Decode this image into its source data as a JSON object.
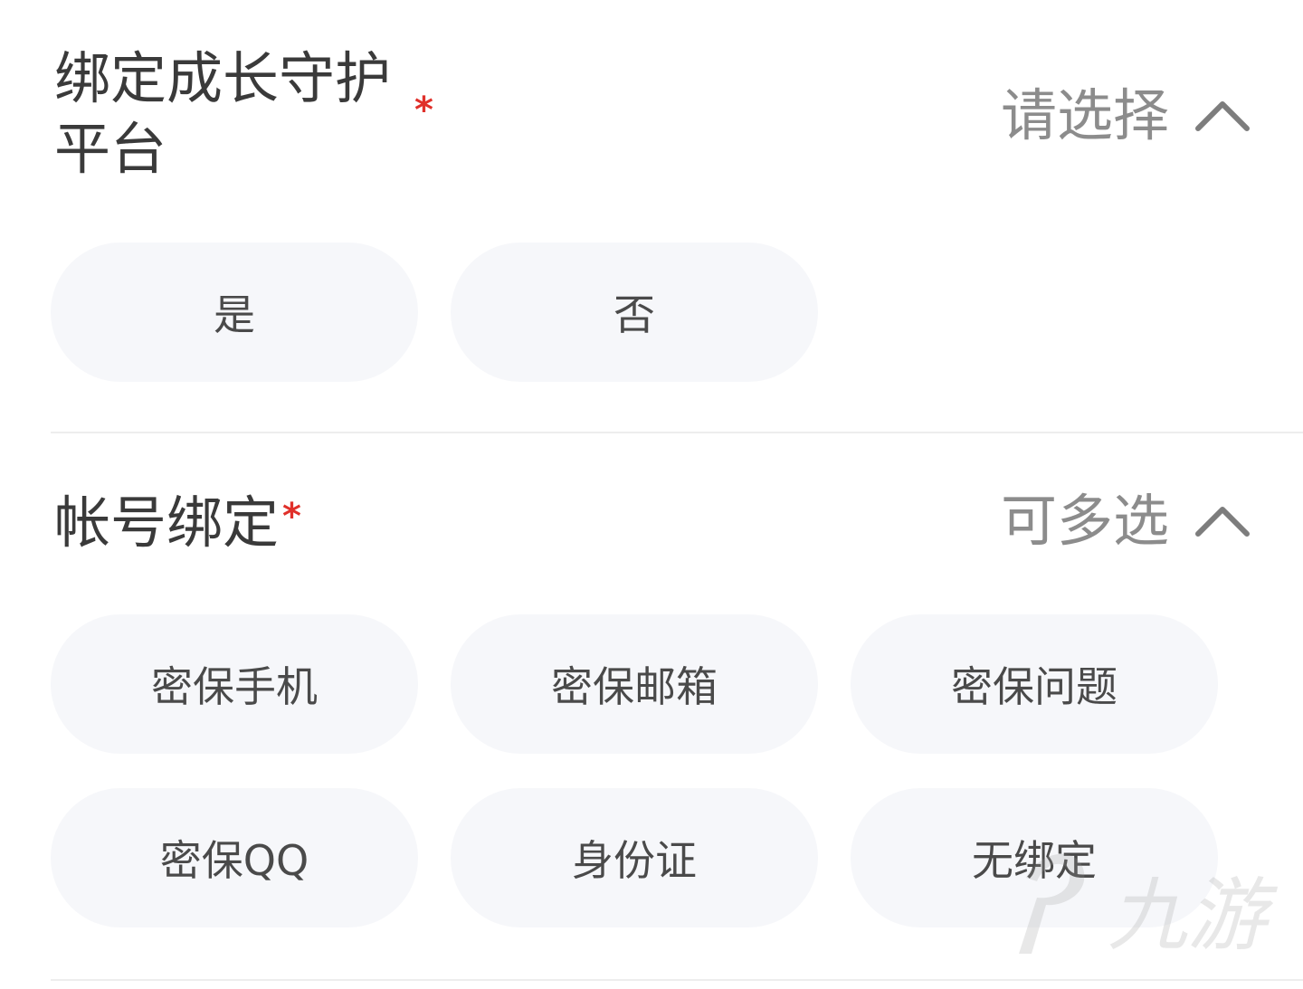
{
  "growth_guard": {
    "title": "绑定成长守护平台",
    "required_mark": "*",
    "picker_text": "请选择",
    "picker_icon": "chevron-up-icon",
    "options": [
      "是",
      "否"
    ]
  },
  "account_binding": {
    "title": "帐号绑定",
    "required_mark": "*",
    "picker_text": "可多选",
    "picker_icon": "chevron-up-icon",
    "options": [
      "密保手机",
      "密保邮箱",
      "密保问题",
      "密保QQ",
      "身份证",
      "无绑定"
    ]
  },
  "watermark": {
    "text": "九游",
    "icon": "jiuyou-logo-icon"
  },
  "colors": {
    "required": "#e0302a",
    "option_bg": "#f6f7fa",
    "placeholder": "#8c8c8c",
    "divider": "#ededed"
  }
}
